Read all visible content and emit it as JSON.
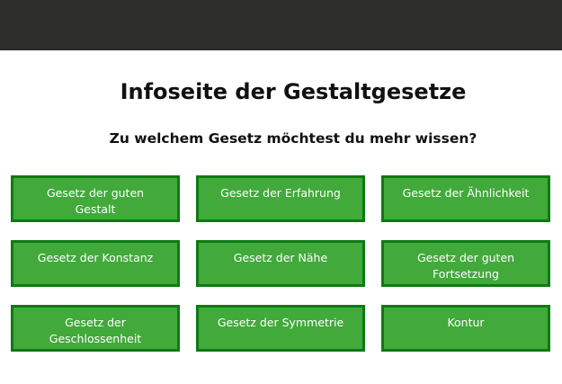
{
  "header": {
    "title": "Infoseite der Gestaltgesetze",
    "subtitle": "Zu welchem Gesetz möchtest du mehr wissen?"
  },
  "buttons": [
    {
      "label": "Gesetz der guten Gestalt"
    },
    {
      "label": "Gesetz der Erfahrung"
    },
    {
      "label": "Gesetz der Ähnlichkeit"
    },
    {
      "label": "Gesetz der Konstanz"
    },
    {
      "label": "Gesetz der Nähe"
    },
    {
      "label": "Gesetz der guten Fortsetzung"
    },
    {
      "label": "Gesetz der Geschlossenheit"
    },
    {
      "label": "Gesetz der Symmetrie"
    },
    {
      "label": "Kontur"
    }
  ],
  "colors": {
    "topbar": "#2d2d2b",
    "button_fill": "#42a93b",
    "button_border": "#0f7a14",
    "button_text": "#ffffff"
  }
}
